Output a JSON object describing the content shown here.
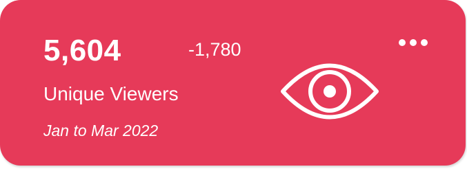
{
  "card": {
    "value": "5,604",
    "delta": "-1,780",
    "label": "Unique Viewers",
    "period": "Jan to Mar 2022",
    "icon": "eye-icon",
    "menu_icon": "more-horizontal-icon",
    "background_color": "#e63a59",
    "text_color": "#ffffff"
  }
}
